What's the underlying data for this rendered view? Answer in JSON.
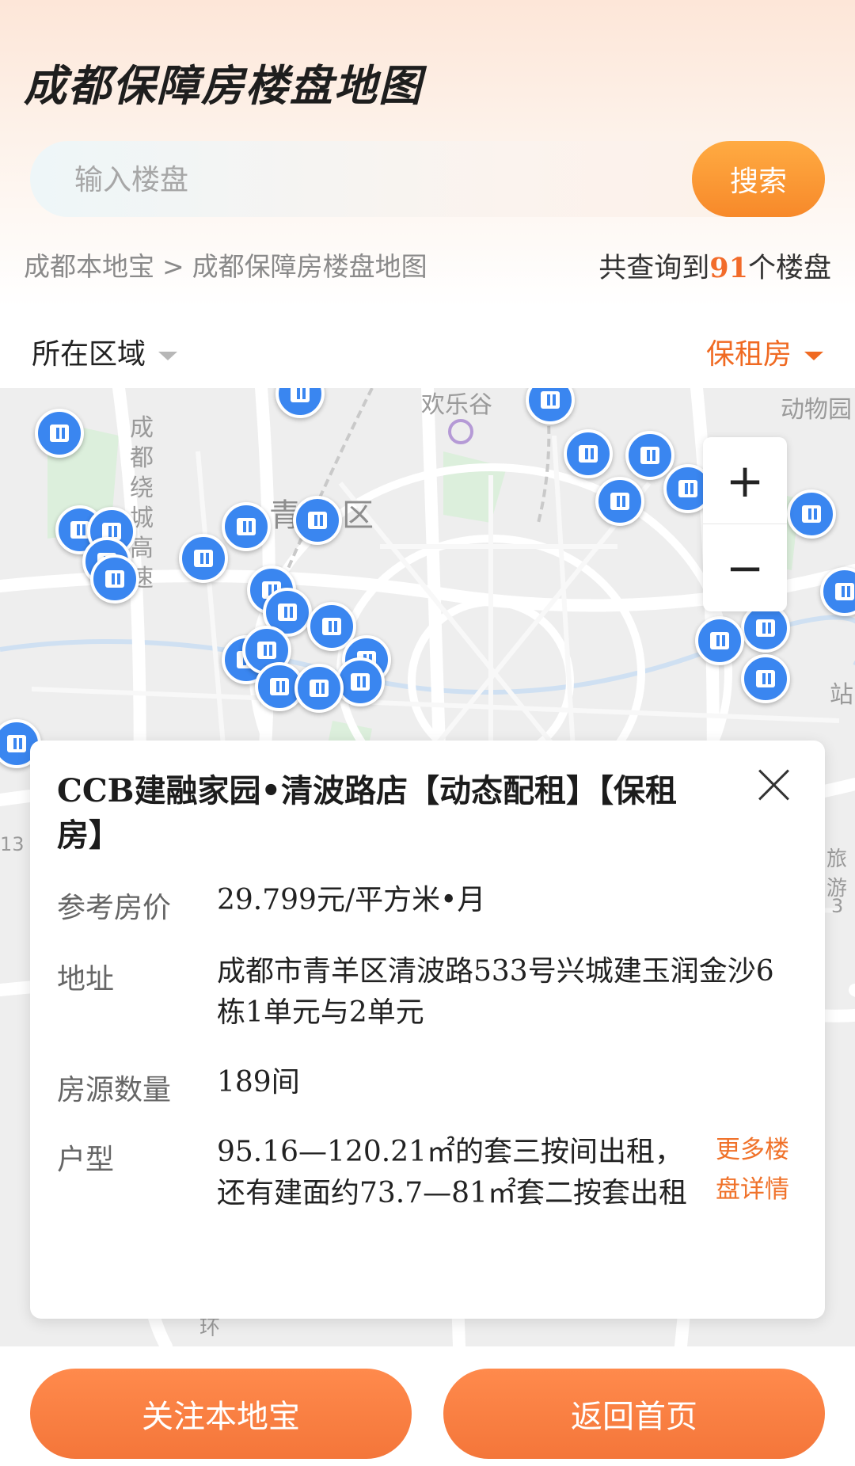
{
  "header": {
    "title": "成都保障房楼盘地图",
    "search": {
      "placeholder": "输入楼盘",
      "button_label": "搜索"
    },
    "breadcrumb": {
      "root": "成都本地宝",
      "separator": ">",
      "current": "成都保障房楼盘地图"
    },
    "result": {
      "prefix": "共查询到",
      "count": "91",
      "suffix": "个楼盘"
    }
  },
  "filters": {
    "region_label": "所在区域",
    "type_label": "保租房"
  },
  "map": {
    "labels": {
      "ring_expressway": "成都绕城高速",
      "district": "青羊区",
      "happy_valley": "欢乐谷",
      "zoo": "动物园",
      "edge_station": "站",
      "edge_num1": "13",
      "edge_num2": "3",
      "edge_lu": "旅游",
      "edge_road": "环"
    },
    "pin_icon": "building-icon",
    "colors": {
      "pin": "#3a86f0",
      "accent": "#f06a22"
    }
  },
  "card": {
    "title": "CCB建融家园•清波路店【动态配租】【保租房】",
    "price_label": "参考房价",
    "price_value": "29.799元/平方米•月",
    "address_label": "地址",
    "address_value": "成都市青羊区清波路533号兴城建玉润金沙6栋1单元与2单元",
    "count_label": "房源数量",
    "count_value": "189间",
    "layout_label": "户型",
    "layout_value": "95.16—120.21㎡的套三按间出租，还有建面约73.7—81㎡套二按套出租",
    "more_link": "更多楼盘详情"
  },
  "footer": {
    "follow_label": "关注本地宝",
    "home_label": "返回首页"
  }
}
